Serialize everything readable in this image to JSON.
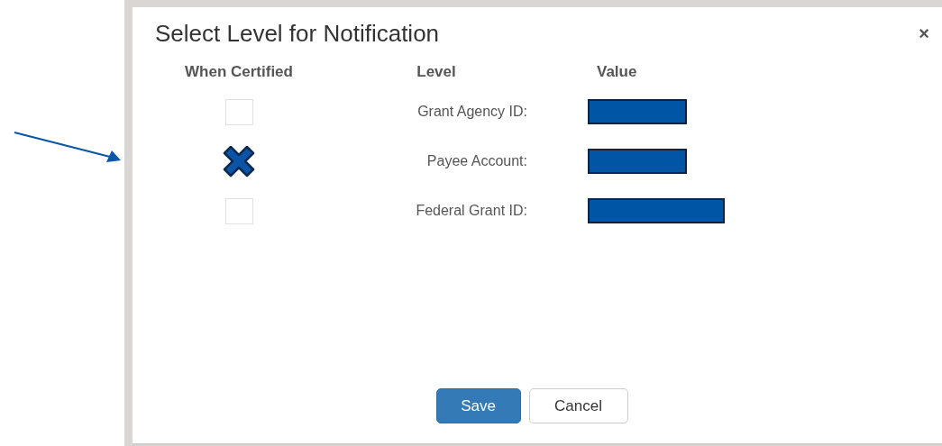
{
  "dialog": {
    "title": "Select Level for Notification",
    "close": "×"
  },
  "columns": [
    "When Certified",
    "Level",
    "Value"
  ],
  "rows": [
    {
      "label": "Grant Agency ID:",
      "checked": false
    },
    {
      "label": "Payee Account:",
      "checked": true
    },
    {
      "label": "Federal Grant ID:",
      "checked": false
    }
  ],
  "buttons": [
    {
      "label": "Save",
      "kind": "primary"
    },
    {
      "label": "Cancel",
      "kind": "default"
    }
  ]
}
